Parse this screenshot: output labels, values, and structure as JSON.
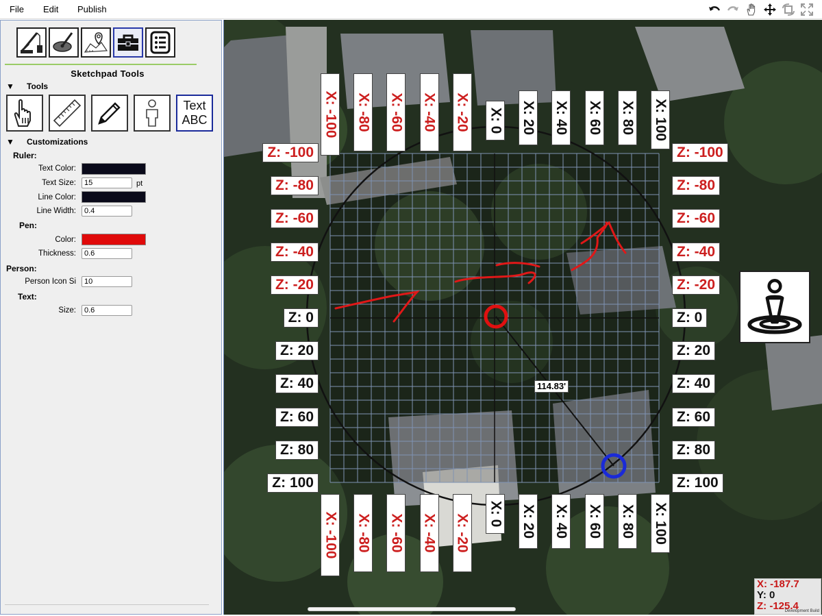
{
  "menu": {
    "file": "File",
    "edit": "Edit",
    "publish": "Publish"
  },
  "toolbar_icons": [
    "undo-icon",
    "redo-icon",
    "hand-icon",
    "move-icon",
    "rotate-icon",
    "fullscreen-icon"
  ],
  "panel": {
    "tabs": [
      "crane-icon",
      "satellite-dish-icon",
      "map-pin-icon",
      "toolbox-icon",
      "list-icon"
    ],
    "active_tab": "toolbox-icon",
    "title": "Sketchpad Tools",
    "tools_heading": "Tools",
    "tools": [
      "hand-pointer-icon",
      "ruler-icon",
      "pencil-icon",
      "person-icon"
    ],
    "text_tool_label_line1": "Text",
    "text_tool_label_line2": "ABC",
    "customizations_heading": "Customizations",
    "ruler": {
      "heading": "Ruler:",
      "text_color_label": "Text Color:",
      "text_color": "#0a0a1a",
      "text_size_label": "Text Size:",
      "text_size": "15",
      "text_size_unit": "pt",
      "line_color_label": "Line Color:",
      "line_color": "#0a0a1a",
      "line_width_label": "Line Width:",
      "line_width": "0.4"
    },
    "pen": {
      "heading": "Pen:",
      "color_label": "Color:",
      "color": "#e00a0a",
      "thickness_label": "Thickness:",
      "thickness": "0.6"
    },
    "person": {
      "heading": "Person:",
      "icon_size_label": "Person Icon Si",
      "icon_size": "10"
    },
    "text": {
      "heading": "Text:",
      "size_label": "Size:",
      "size": "0.6"
    }
  },
  "map": {
    "x_labels": [
      "X: -100",
      "X: -80",
      "X: -60",
      "X: -40",
      "X: -20",
      "X: 0",
      "X: 20",
      "X: 40",
      "X: 60",
      "X: 80",
      "X: 100"
    ],
    "z_labels": [
      "Z: -100",
      "Z: -80",
      "Z: -60",
      "Z: -40",
      "Z: -20",
      "Z: 0",
      "Z: 20",
      "Z: 40",
      "Z: 60",
      "Z: 80",
      "Z: 100"
    ],
    "measurement": "114.83'",
    "colors": {
      "negative_label": "#cc1f1f",
      "positive_label": "#111111",
      "start_marker": "#e01010",
      "end_marker": "#1a2ad8"
    },
    "person_button_icon": "person-location-icon",
    "coords": {
      "x": "X: -187.7",
      "y": "Y: 0",
      "z": "Z: -125.4"
    },
    "dev_build": "Development Build"
  }
}
